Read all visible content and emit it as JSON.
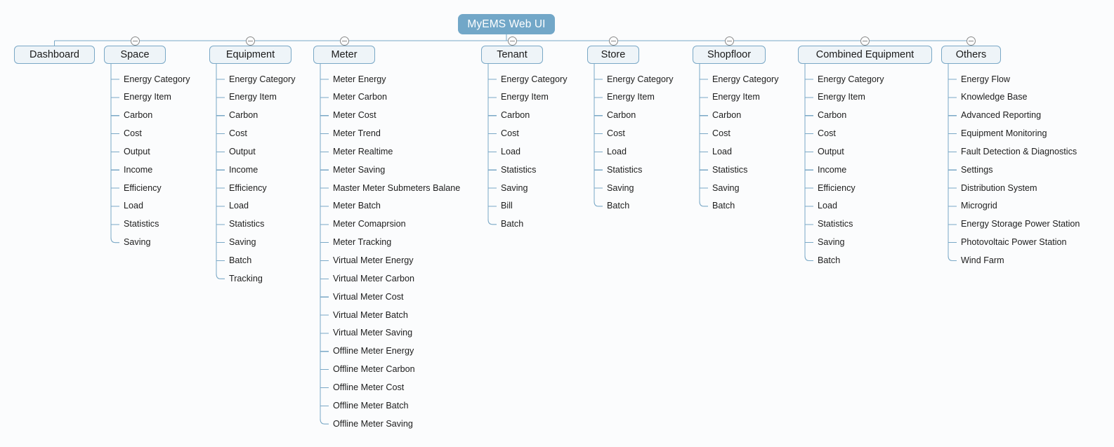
{
  "diagram": {
    "title": "MyEMS Web UI",
    "type": "tree-mindmap",
    "colors": {
      "root_fill": "#72a7c8",
      "root_text": "#ffffff",
      "branch_fill": "#eef4f8",
      "branch_border": "#7aa8c6",
      "connector": "#7aa8c6",
      "leaf_text": "#1d1d1d",
      "background": "#fbfcfd"
    },
    "toggle_icon": "collapse-minus-icon"
  },
  "branches": [
    {
      "label": "Dashboard",
      "has_toggle": false,
      "children": []
    },
    {
      "label": "Space",
      "has_toggle": true,
      "children": [
        "Energy Category",
        "Energy Item",
        "Carbon",
        "Cost",
        "Output",
        "Income",
        "Efficiency",
        "Load",
        "Statistics",
        "Saving"
      ]
    },
    {
      "label": "Equipment",
      "has_toggle": true,
      "children": [
        "Energy Category",
        "Energy Item",
        "Carbon",
        "Cost",
        "Output",
        "Income",
        "Efficiency",
        "Load",
        "Statistics",
        "Saving",
        "Batch",
        "Tracking"
      ]
    },
    {
      "label": "Meter",
      "has_toggle": true,
      "children": [
        "Meter Energy",
        "Meter Carbon",
        "Meter Cost",
        "Meter Trend",
        "Meter Realtime",
        "Meter Saving",
        "Master Meter Submeters Balane",
        "Meter Batch",
        "Meter Comaprsion",
        "Meter Tracking",
        "Virtual Meter Energy",
        "Virtual Meter Carbon",
        "Virtual Meter Cost",
        "Virtual Meter Batch",
        "Virtual Meter Saving",
        "Offline Meter Energy",
        "Offline Meter Carbon",
        "Offline Meter Cost",
        "Offline Meter Batch",
        "Offline Meter Saving"
      ]
    },
    {
      "label": "Tenant",
      "has_toggle": true,
      "children": [
        "Energy Category",
        "Energy Item",
        "Carbon",
        "Cost",
        "Load",
        "Statistics",
        "Saving",
        "Bill",
        "Batch"
      ]
    },
    {
      "label": "Store",
      "has_toggle": true,
      "children": [
        "Energy Category",
        "Energy Item",
        "Carbon",
        "Cost",
        "Load",
        "Statistics",
        "Saving",
        "Batch"
      ]
    },
    {
      "label": "Shopfloor",
      "has_toggle": true,
      "children": [
        "Energy Category",
        "Energy Item",
        "Carbon",
        "Cost",
        "Load",
        "Statistics",
        "Saving",
        "Batch"
      ]
    },
    {
      "label": "Combined Equipment",
      "has_toggle": true,
      "children": [
        "Energy Category",
        "Energy Item",
        "Carbon",
        "Cost",
        "Output",
        "Income",
        "Efficiency",
        "Load",
        "Statistics",
        "Saving",
        "Batch"
      ]
    },
    {
      "label": "Others",
      "has_toggle": true,
      "children": [
        "Energy Flow",
        "Knowledge Base",
        "Advanced Reporting",
        "Equipment Monitoring",
        "Fault Detection & Diagnostics",
        "Settings",
        "Distribution System",
        "Microgrid",
        "Energy Storage Power Station",
        "Photovoltaic Power Station",
        "Wind Farm"
      ]
    }
  ]
}
